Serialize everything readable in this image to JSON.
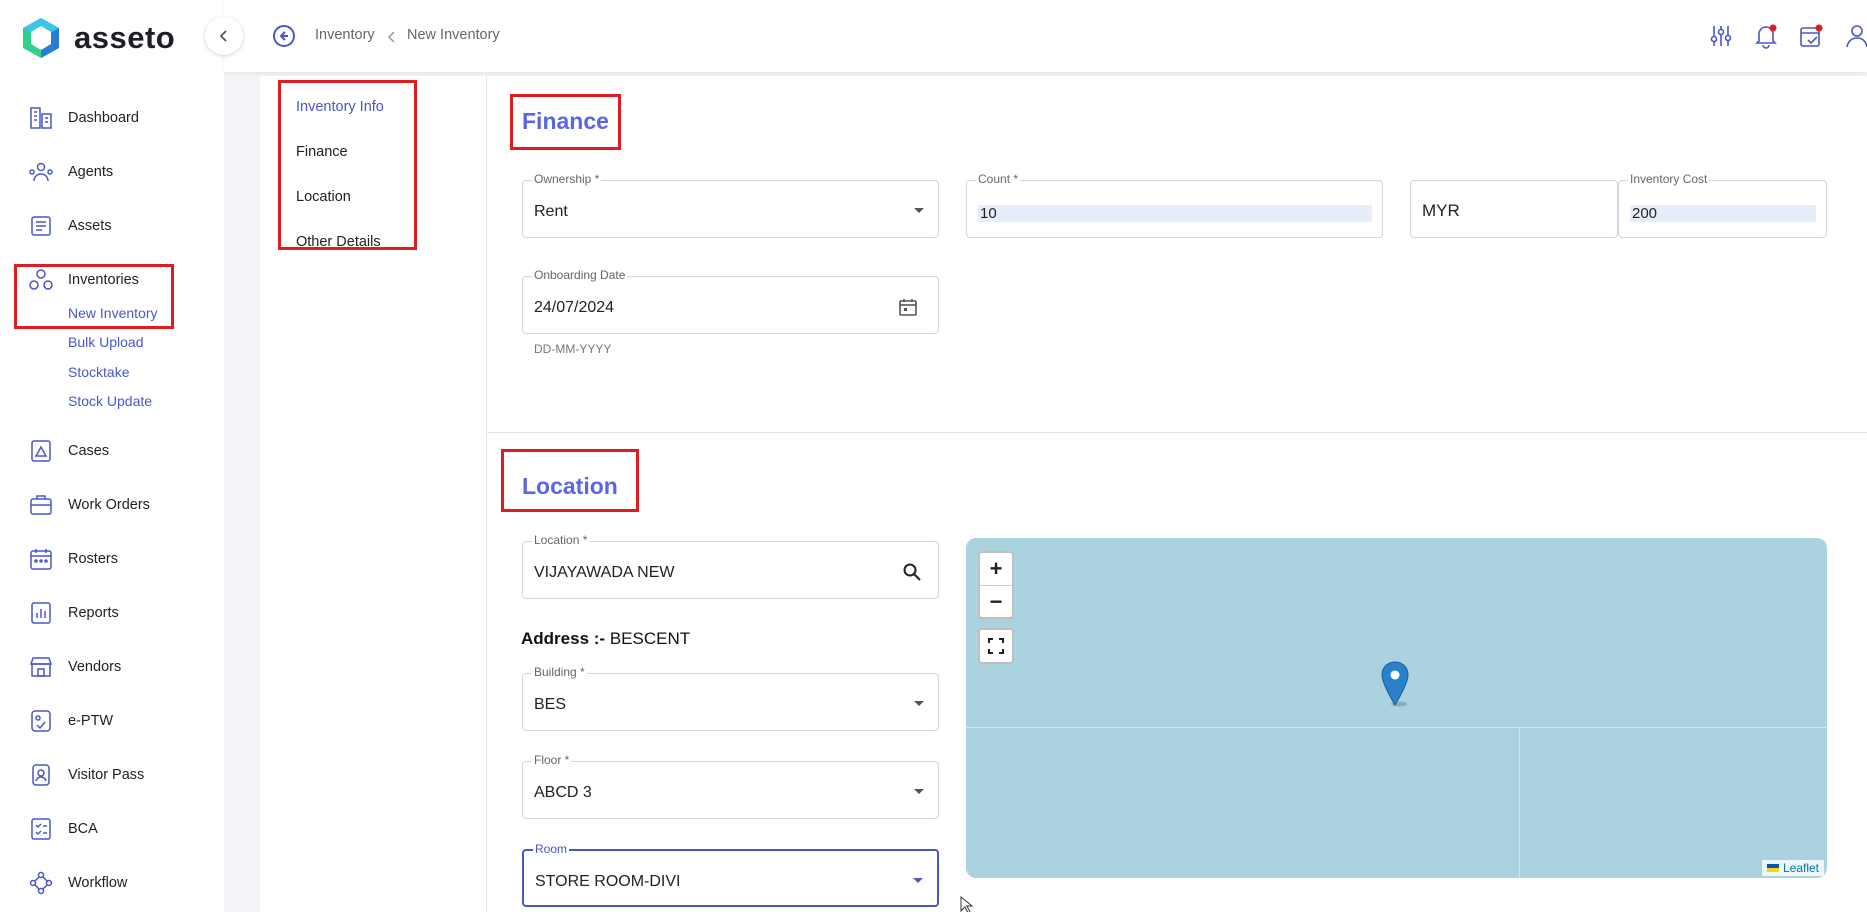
{
  "app": {
    "name": "asseto"
  },
  "sidebar": {
    "items": [
      {
        "label": "Dashboard",
        "icon": "dashboard-icon"
      },
      {
        "label": "Agents",
        "icon": "agents-icon"
      },
      {
        "label": "Assets",
        "icon": "assets-icon"
      },
      {
        "label": "Inventories",
        "icon": "inventories-icon"
      },
      {
        "label": "Cases",
        "icon": "cases-icon"
      },
      {
        "label": "Work Orders",
        "icon": "work-orders-icon"
      },
      {
        "label": "Rosters",
        "icon": "rosters-icon"
      },
      {
        "label": "Reports",
        "icon": "reports-icon"
      },
      {
        "label": "Vendors",
        "icon": "vendors-icon"
      },
      {
        "label": "e-PTW",
        "icon": "eptw-icon"
      },
      {
        "label": "Visitor Pass",
        "icon": "visitor-pass-icon"
      },
      {
        "label": "BCA",
        "icon": "bca-icon"
      },
      {
        "label": "Workflow",
        "icon": "workflow-icon"
      }
    ],
    "inventory_sub": [
      "New Inventory",
      "Bulk Upload",
      "Stocktake",
      "Stock Update"
    ]
  },
  "breadcrumb": {
    "root": "Inventory",
    "current": "New Inventory"
  },
  "subnav": [
    "Inventory Info",
    "Finance",
    "Location",
    "Other Details"
  ],
  "finance": {
    "title": "Finance",
    "ownership": {
      "label": "Ownership *",
      "value": "Rent"
    },
    "count": {
      "label": "Count *",
      "value": "10"
    },
    "currency": {
      "value": "MYR"
    },
    "cost": {
      "label": "Inventory Cost",
      "value": "200"
    },
    "onboarding": {
      "label": "Onboarding Date",
      "value": "24/07/2024",
      "helper": "DD-MM-YYYY"
    }
  },
  "location": {
    "title": "Location",
    "location": {
      "label": "Location *",
      "value": "VIJAYAWADA NEW"
    },
    "address_label": "Address :-",
    "address_value": "BESCENT",
    "building": {
      "label": "Building *",
      "value": "BES"
    },
    "floor": {
      "label": "Floor *",
      "value": "ABCD 3"
    },
    "room": {
      "label": "Room",
      "value": "STORE ROOM-DIVI"
    }
  },
  "map": {
    "zoom_in": "+",
    "zoom_out": "−",
    "attribution": "Leaflet"
  },
  "colors": {
    "accent": "#5a66e6",
    "link": "#4a56c9",
    "highlight": "#e11b22",
    "map_water": "#aad3df"
  }
}
